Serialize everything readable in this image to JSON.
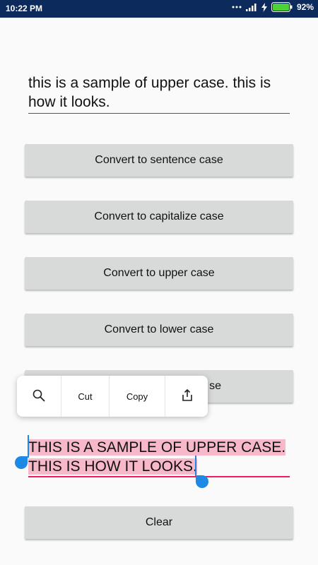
{
  "status_bar": {
    "time": "10:22 PM",
    "battery_percent": "92%"
  },
  "input_top": {
    "value": "this is a sample of upper case. this is how it looks."
  },
  "buttons": {
    "sentence": "Convert to sentence case",
    "capitalize": "Convert to capitalize case",
    "upper": "Convert to upper case",
    "lower": "Convert to lower case",
    "hidden_partial": "se",
    "clear": "Clear"
  },
  "context_menu": {
    "cut": "Cut",
    "copy": "Copy"
  },
  "output": {
    "line1": "THIS IS A SAMPLE OF UPPER CASE.",
    "line2": "THIS IS HOW IT LOOKS."
  },
  "icons": {
    "search": "search-icon",
    "share": "share-icon",
    "wifi": "wifi-icon",
    "signal": "signal-icon",
    "charging": "charging-icon",
    "battery": "battery-icon"
  },
  "colors": {
    "status_bar": "#0d2a5c",
    "button_bg": "#d8d9d9",
    "selection": "#f7b8c9",
    "accent": "#e91e63",
    "handle": "#1e88e5"
  }
}
